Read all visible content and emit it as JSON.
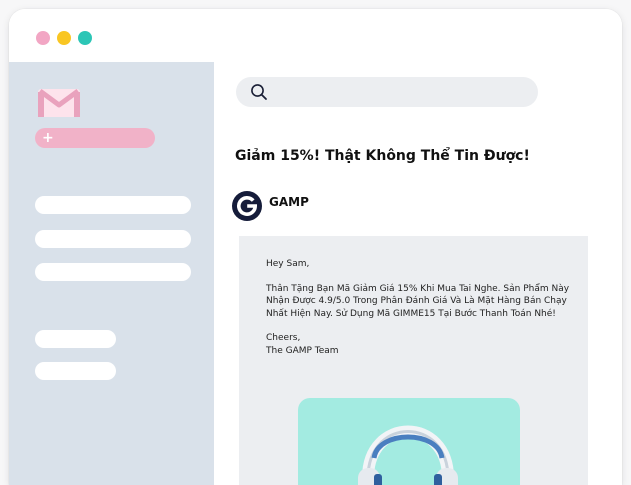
{
  "window": {
    "traffic_lights": [
      "#f2a6c4",
      "#f9c623",
      "#2cc6b6"
    ]
  },
  "sidebar": {
    "logo_icon": "gmail-icon",
    "compose_icon": "plus",
    "compose_symbol": "+"
  },
  "search": {
    "icon": "search-icon"
  },
  "email": {
    "subject": "Giảm 15%! Thật Không Thể Tin Được!",
    "sender": "GAMP",
    "greeting": "Hey Sam,",
    "body": "Thân Tặng Bạn Mã Giảm Giá 15% Khi Mua Tai Nghe. Sản Phẩm Này Nhận Được 4.9/5.0 Trong Phân Đánh Giá Và Là Mặt Hàng Bán Chạy Nhất Hiện Nay. Sử Dụng Mã GIMME15 Tại Bước Thanh Toán Nhé!",
    "signoff": "Cheers,",
    "signature": "The GAMP Team",
    "product_image_icon": "headphones-icon"
  },
  "colors": {
    "sidebar_bg": "#d9e1ea",
    "compose": "#f1b2c8",
    "brand": "#151c3a",
    "product_bg": "#a3ebe1"
  }
}
